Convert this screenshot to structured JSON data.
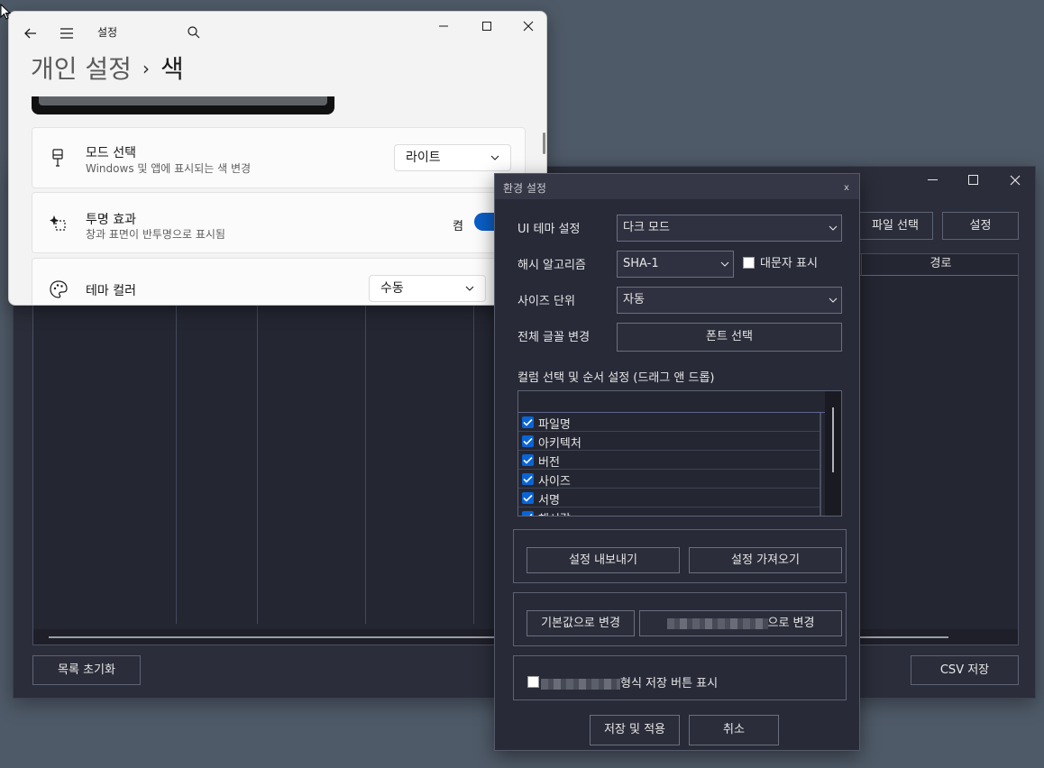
{
  "main_window": {
    "file_select_label": "파일 선택",
    "settings_label": "설정",
    "path_column_label": "경로",
    "reset_list_label": "목록 초기화",
    "csv_save_label": "CSV 저장"
  },
  "win_settings": {
    "title": "설정",
    "breadcrumb_parent": "개인 설정",
    "breadcrumb_sep": "›",
    "breadcrumb_current": "색",
    "mode": {
      "title": "모드 선택",
      "subtitle": "Windows 및 앱에 표시되는 색 변경",
      "value": "라이트"
    },
    "transparency": {
      "title": "투명 효과",
      "subtitle": "창과 표면이 반투명으로 표시됨",
      "state": "켬"
    },
    "accent": {
      "title": "테마 컬러",
      "value": "수동"
    }
  },
  "dialog": {
    "title": "환경 설정",
    "close": "x",
    "ui_theme_label": "UI 테마 설정",
    "ui_theme_value": "다크 모드",
    "hash_label": "해시 알고리즘",
    "hash_value": "SHA-1",
    "uppercase_label": "대문자 표시",
    "size_unit_label": "사이즈 단위",
    "size_unit_value": "자동",
    "font_label": "전체 글꼴 변경",
    "font_button": "폰트 선택",
    "columns_label": "컬럼 선택 및 순서 설정 (드래그 앤 드롭)",
    "columns": [
      "파일명",
      "아키텍처",
      "버전",
      "사이즈",
      "서명",
      "해시값"
    ],
    "export_label": "설정 내보내기",
    "import_label": "설정 가져오기",
    "default_label": "기본값으로 변경",
    "change_suffix": "으로 변경",
    "format_suffix": "형식 저장 버튼 표시",
    "save_apply_label": "저장 및 적용",
    "cancel_label": "취소"
  },
  "colors": {
    "desktop": "#4f5a68",
    "dark_bg": "#282a38",
    "accent_blue": "#0a5ec4",
    "light_bg": "#f3f3f3"
  }
}
